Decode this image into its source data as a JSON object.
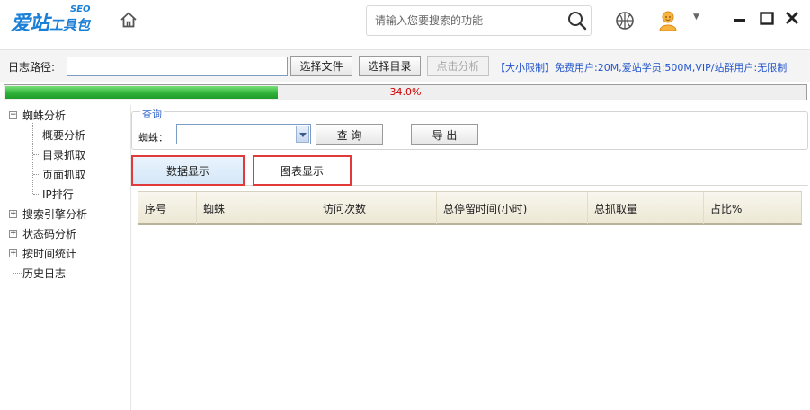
{
  "app": {
    "logo_main": "爱站",
    "logo_seo": "SEO",
    "logo_tool": "工具包",
    "search_placeholder": "请输入您要搜索的功能"
  },
  "pathrow": {
    "label": "日志路径:",
    "path_value": "",
    "choose_file": "选择文件",
    "choose_dir": "选择目录",
    "analyze": "点击分析",
    "limit_text": "【大小限制】免费用户:20M,爱站学员:500M,VIP/站群用户:无限制"
  },
  "progress": {
    "percent": 34.0,
    "label": "34.0%"
  },
  "tree": {
    "root": "蜘蛛分析",
    "children": [
      "概要分析",
      "目录抓取",
      "页面抓取",
      "IP排行"
    ],
    "items": [
      "搜索引擎分析",
      "状态码分析",
      "按时间统计",
      "历史日志"
    ]
  },
  "query": {
    "legend": "查询",
    "spider_label": "蜘蛛：",
    "spider_value": "",
    "search_btn": "查  询",
    "export_btn": "导  出"
  },
  "tabs": [
    "数据显示",
    "图表显示"
  ],
  "table": {
    "columns": [
      "序号",
      "蜘蛛",
      "访问次数",
      "总停留时间(小时)",
      "总抓取量",
      "占比%"
    ]
  },
  "colors": {
    "accent": "#1a7fd6",
    "progress": "#2fb33a",
    "highlight_border": "#e03a3a",
    "limit_text": "#2255cc"
  }
}
